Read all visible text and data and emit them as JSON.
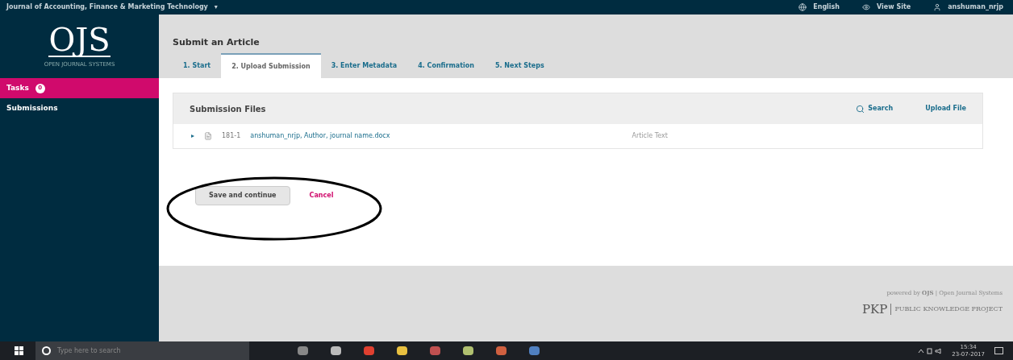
{
  "top_bar": {
    "journal": "Journal of Accounting, Finance & Marketing Technology",
    "caret": "▾",
    "links": [
      {
        "kind": "language",
        "label": "English"
      },
      {
        "kind": "view",
        "label": "View Site"
      },
      {
        "kind": "user",
        "label": "anshuman_nrjp"
      }
    ]
  },
  "logo": {
    "text": "OJS",
    "subtitle": "OPEN JOURNAL SYSTEMS"
  },
  "sidebar": {
    "items": [
      {
        "label": "Tasks",
        "badge": "0",
        "selected": true
      },
      {
        "label": "Submissions",
        "selected": false
      }
    ]
  },
  "page_title": "Submit an Article",
  "tabs": [
    {
      "label": "1. Start",
      "selected": false
    },
    {
      "label": "2. Upload Submission",
      "selected": true
    },
    {
      "label": "3. Enter Metadata",
      "selected": false
    },
    {
      "label": "4. Confirmation",
      "selected": false
    },
    {
      "label": "5. Next Steps",
      "selected": false
    }
  ],
  "files_panel": {
    "title": "Submission Files",
    "actions": [
      {
        "kind": "search",
        "label": "Search"
      },
      {
        "kind": "upload",
        "label": "Upload File"
      }
    ],
    "rows": [
      {
        "expander": "▸",
        "id": "181-1",
        "name": "anshuman_nrjp, Author, journal name.docx",
        "type": "Article Text"
      }
    ]
  },
  "buttons": {
    "save": "Save and continue",
    "cancel": "Cancel"
  },
  "annotation": {
    "kind": "ellipse"
  },
  "footer": {
    "line1": "powered by **OJS** | Open Journal Systems",
    "pkp": "PKP",
    "line2": "PUBLIC KNOWLEDGE PROJECT"
  },
  "taskbar": {
    "search_placeholder": "Type here to search",
    "time": "15:34",
    "date": "23-07-2017"
  }
}
